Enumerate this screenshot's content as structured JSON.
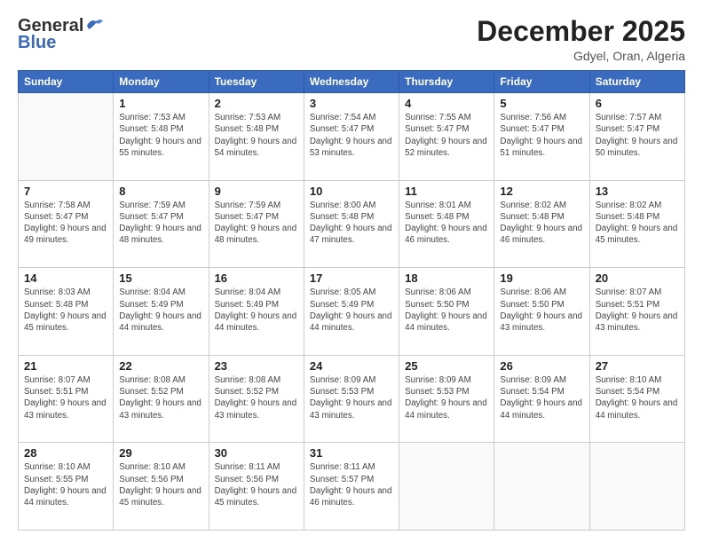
{
  "header": {
    "logo_general": "General",
    "logo_blue": "Blue",
    "month_title": "December 2025",
    "location": "Gdyel, Oran, Algeria"
  },
  "days_of_week": [
    "Sunday",
    "Monday",
    "Tuesday",
    "Wednesday",
    "Thursday",
    "Friday",
    "Saturday"
  ],
  "weeks": [
    [
      {
        "day": "",
        "sunrise": "",
        "sunset": "",
        "daylight": ""
      },
      {
        "day": "1",
        "sunrise": "Sunrise: 7:53 AM",
        "sunset": "Sunset: 5:48 PM",
        "daylight": "Daylight: 9 hours and 55 minutes."
      },
      {
        "day": "2",
        "sunrise": "Sunrise: 7:53 AM",
        "sunset": "Sunset: 5:48 PM",
        "daylight": "Daylight: 9 hours and 54 minutes."
      },
      {
        "day": "3",
        "sunrise": "Sunrise: 7:54 AM",
        "sunset": "Sunset: 5:47 PM",
        "daylight": "Daylight: 9 hours and 53 minutes."
      },
      {
        "day": "4",
        "sunrise": "Sunrise: 7:55 AM",
        "sunset": "Sunset: 5:47 PM",
        "daylight": "Daylight: 9 hours and 52 minutes."
      },
      {
        "day": "5",
        "sunrise": "Sunrise: 7:56 AM",
        "sunset": "Sunset: 5:47 PM",
        "daylight": "Daylight: 9 hours and 51 minutes."
      },
      {
        "day": "6",
        "sunrise": "Sunrise: 7:57 AM",
        "sunset": "Sunset: 5:47 PM",
        "daylight": "Daylight: 9 hours and 50 minutes."
      }
    ],
    [
      {
        "day": "7",
        "sunrise": "Sunrise: 7:58 AM",
        "sunset": "Sunset: 5:47 PM",
        "daylight": "Daylight: 9 hours and 49 minutes."
      },
      {
        "day": "8",
        "sunrise": "Sunrise: 7:59 AM",
        "sunset": "Sunset: 5:47 PM",
        "daylight": "Daylight: 9 hours and 48 minutes."
      },
      {
        "day": "9",
        "sunrise": "Sunrise: 7:59 AM",
        "sunset": "Sunset: 5:47 PM",
        "daylight": "Daylight: 9 hours and 48 minutes."
      },
      {
        "day": "10",
        "sunrise": "Sunrise: 8:00 AM",
        "sunset": "Sunset: 5:48 PM",
        "daylight": "Daylight: 9 hours and 47 minutes."
      },
      {
        "day": "11",
        "sunrise": "Sunrise: 8:01 AM",
        "sunset": "Sunset: 5:48 PM",
        "daylight": "Daylight: 9 hours and 46 minutes."
      },
      {
        "day": "12",
        "sunrise": "Sunrise: 8:02 AM",
        "sunset": "Sunset: 5:48 PM",
        "daylight": "Daylight: 9 hours and 46 minutes."
      },
      {
        "day": "13",
        "sunrise": "Sunrise: 8:02 AM",
        "sunset": "Sunset: 5:48 PM",
        "daylight": "Daylight: 9 hours and 45 minutes."
      }
    ],
    [
      {
        "day": "14",
        "sunrise": "Sunrise: 8:03 AM",
        "sunset": "Sunset: 5:48 PM",
        "daylight": "Daylight: 9 hours and 45 minutes."
      },
      {
        "day": "15",
        "sunrise": "Sunrise: 8:04 AM",
        "sunset": "Sunset: 5:49 PM",
        "daylight": "Daylight: 9 hours and 44 minutes."
      },
      {
        "day": "16",
        "sunrise": "Sunrise: 8:04 AM",
        "sunset": "Sunset: 5:49 PM",
        "daylight": "Daylight: 9 hours and 44 minutes."
      },
      {
        "day": "17",
        "sunrise": "Sunrise: 8:05 AM",
        "sunset": "Sunset: 5:49 PM",
        "daylight": "Daylight: 9 hours and 44 minutes."
      },
      {
        "day": "18",
        "sunrise": "Sunrise: 8:06 AM",
        "sunset": "Sunset: 5:50 PM",
        "daylight": "Daylight: 9 hours and 44 minutes."
      },
      {
        "day": "19",
        "sunrise": "Sunrise: 8:06 AM",
        "sunset": "Sunset: 5:50 PM",
        "daylight": "Daylight: 9 hours and 43 minutes."
      },
      {
        "day": "20",
        "sunrise": "Sunrise: 8:07 AM",
        "sunset": "Sunset: 5:51 PM",
        "daylight": "Daylight: 9 hours and 43 minutes."
      }
    ],
    [
      {
        "day": "21",
        "sunrise": "Sunrise: 8:07 AM",
        "sunset": "Sunset: 5:51 PM",
        "daylight": "Daylight: 9 hours and 43 minutes."
      },
      {
        "day": "22",
        "sunrise": "Sunrise: 8:08 AM",
        "sunset": "Sunset: 5:52 PM",
        "daylight": "Daylight: 9 hours and 43 minutes."
      },
      {
        "day": "23",
        "sunrise": "Sunrise: 8:08 AM",
        "sunset": "Sunset: 5:52 PM",
        "daylight": "Daylight: 9 hours and 43 minutes."
      },
      {
        "day": "24",
        "sunrise": "Sunrise: 8:09 AM",
        "sunset": "Sunset: 5:53 PM",
        "daylight": "Daylight: 9 hours and 43 minutes."
      },
      {
        "day": "25",
        "sunrise": "Sunrise: 8:09 AM",
        "sunset": "Sunset: 5:53 PM",
        "daylight": "Daylight: 9 hours and 44 minutes."
      },
      {
        "day": "26",
        "sunrise": "Sunrise: 8:09 AM",
        "sunset": "Sunset: 5:54 PM",
        "daylight": "Daylight: 9 hours and 44 minutes."
      },
      {
        "day": "27",
        "sunrise": "Sunrise: 8:10 AM",
        "sunset": "Sunset: 5:54 PM",
        "daylight": "Daylight: 9 hours and 44 minutes."
      }
    ],
    [
      {
        "day": "28",
        "sunrise": "Sunrise: 8:10 AM",
        "sunset": "Sunset: 5:55 PM",
        "daylight": "Daylight: 9 hours and 44 minutes."
      },
      {
        "day": "29",
        "sunrise": "Sunrise: 8:10 AM",
        "sunset": "Sunset: 5:56 PM",
        "daylight": "Daylight: 9 hours and 45 minutes."
      },
      {
        "day": "30",
        "sunrise": "Sunrise: 8:11 AM",
        "sunset": "Sunset: 5:56 PM",
        "daylight": "Daylight: 9 hours and 45 minutes."
      },
      {
        "day": "31",
        "sunrise": "Sunrise: 8:11 AM",
        "sunset": "Sunset: 5:57 PM",
        "daylight": "Daylight: 9 hours and 46 minutes."
      },
      {
        "day": "",
        "sunrise": "",
        "sunset": "",
        "daylight": ""
      },
      {
        "day": "",
        "sunrise": "",
        "sunset": "",
        "daylight": ""
      },
      {
        "day": "",
        "sunrise": "",
        "sunset": "",
        "daylight": ""
      }
    ]
  ]
}
